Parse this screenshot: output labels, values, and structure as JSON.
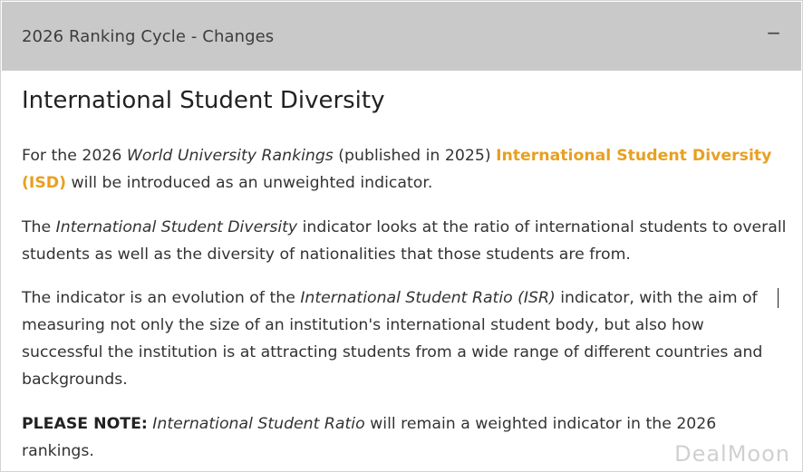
{
  "accordion": {
    "title": "2026 Ranking Cycle - Changes",
    "toggle_symbol": "−"
  },
  "section": {
    "title": "International Student Diversity",
    "p1": {
      "a": "For the 2026 ",
      "b_italic": "World University Rankings",
      "c": " (published in 2025) ",
      "d_highlight": "International Student Diversity (ISD)",
      "e": " will be introduced as an unweighted indicator."
    },
    "p2": {
      "a": "The ",
      "b_italic": "International Student Diversity",
      "c": " indicator looks at the ratio of international students to overall students as well as the diversity of nationalities that those students are from."
    },
    "p3": {
      "a": "The indicator is an evolution of the ",
      "b_italic": "International Student Ratio (ISR)",
      "c": " indicator, with the aim of measuring not only the size of an institution's international student body, but also how successful the institution is at attracting students from a wide range of different countries and backgrounds."
    },
    "p4": {
      "a_bold": "PLEASE NOTE:",
      "b_italic": " International Student Ratio",
      "c": " will remain a weighted indicator in the 2026 rankings."
    }
  },
  "watermark": "DealMoon",
  "colors": {
    "header_bg": "#c9c9c9",
    "highlight": "#e8a021"
  }
}
